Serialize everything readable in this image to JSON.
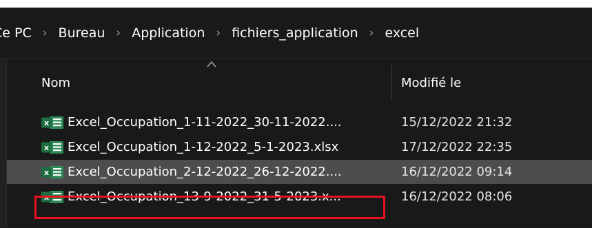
{
  "breadcrumb": {
    "items": [
      "Ce PC",
      "Bureau",
      "Application",
      "fichiers_application",
      "excel"
    ],
    "separator": "›"
  },
  "columns": {
    "name": "Nom",
    "modified": "Modifié le"
  },
  "files": [
    {
      "name": "Excel_Occupation_1-11-2022_30-11-2022....",
      "modified": "15/12/2022 21:32",
      "icon": "excel-file-icon"
    },
    {
      "name": "Excel_Occupation_1-12-2022_5-1-2023.xlsx",
      "modified": "17/12/2022 22:35",
      "icon": "excel-file-icon"
    },
    {
      "name": "Excel_Occupation_2-12-2022_26-12-2022....",
      "modified": "16/12/2022 09:14",
      "icon": "excel-file-icon"
    },
    {
      "name": "Excel_Occupation_13-9-2022_31-5-2023.x...",
      "modified": "16/12/2022 08:06",
      "icon": "excel-file-icon"
    }
  ],
  "colors": {
    "background": "#191919",
    "selected_row": "#4d4d4d",
    "excel_green": "#1d6f42",
    "highlight_border": "#e81123"
  }
}
